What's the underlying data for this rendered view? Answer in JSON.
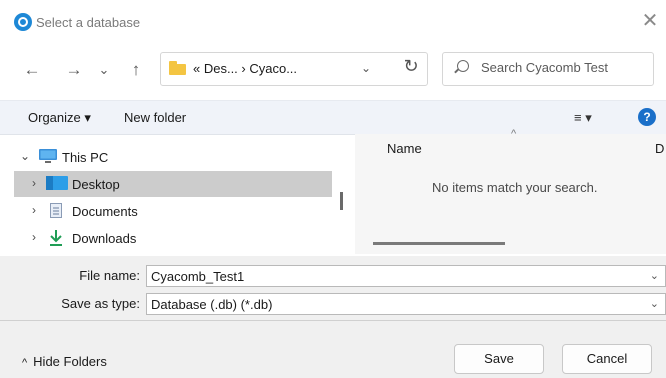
{
  "window": {
    "title": "Select a database",
    "close_glyph": "✕"
  },
  "nav": {
    "back": "←",
    "forward": "→",
    "recent": "⌄",
    "up": "↑"
  },
  "address": {
    "path": "« Des... › Cyaco...",
    "dropdown": "⌄",
    "refresh": "↻"
  },
  "search": {
    "placeholder": "Search Cyacomb Test",
    "value": ""
  },
  "toolbar": {
    "organize": "Organize ▾",
    "new_folder": "New folder",
    "view": "≡  ▾",
    "help": "?"
  },
  "tree": {
    "items": [
      {
        "label": "This PC",
        "chevron": "⌄",
        "icon": "monitor-icon"
      },
      {
        "label": "Desktop",
        "chevron": "›",
        "icon": "desktop-folder-icon",
        "selected": true
      },
      {
        "label": "Documents",
        "chevron": "›",
        "icon": "documents-icon"
      },
      {
        "label": "Downloads",
        "chevron": "›",
        "icon": "download-arrow-icon"
      }
    ]
  },
  "filelist": {
    "columns": [
      "Name",
      "D"
    ],
    "sort_caret": "^",
    "empty_message": "No items match your search."
  },
  "form": {
    "file_name_label": "File name:",
    "file_name_value": "Cyacomb_Test1",
    "save_type_label": "Save as type:",
    "save_type_value": "Database (.db) (*.db)",
    "chevron": "⌄"
  },
  "footer": {
    "hide_folders": "Hide Folders",
    "hide_chevron": "^",
    "save": "Save",
    "cancel": "Cancel"
  },
  "colors": {
    "accent": "#1a6fc9",
    "toolbar_bg": "#f0f3f9",
    "footer_bg": "#f0f0f0",
    "selection": "#cccccc"
  }
}
